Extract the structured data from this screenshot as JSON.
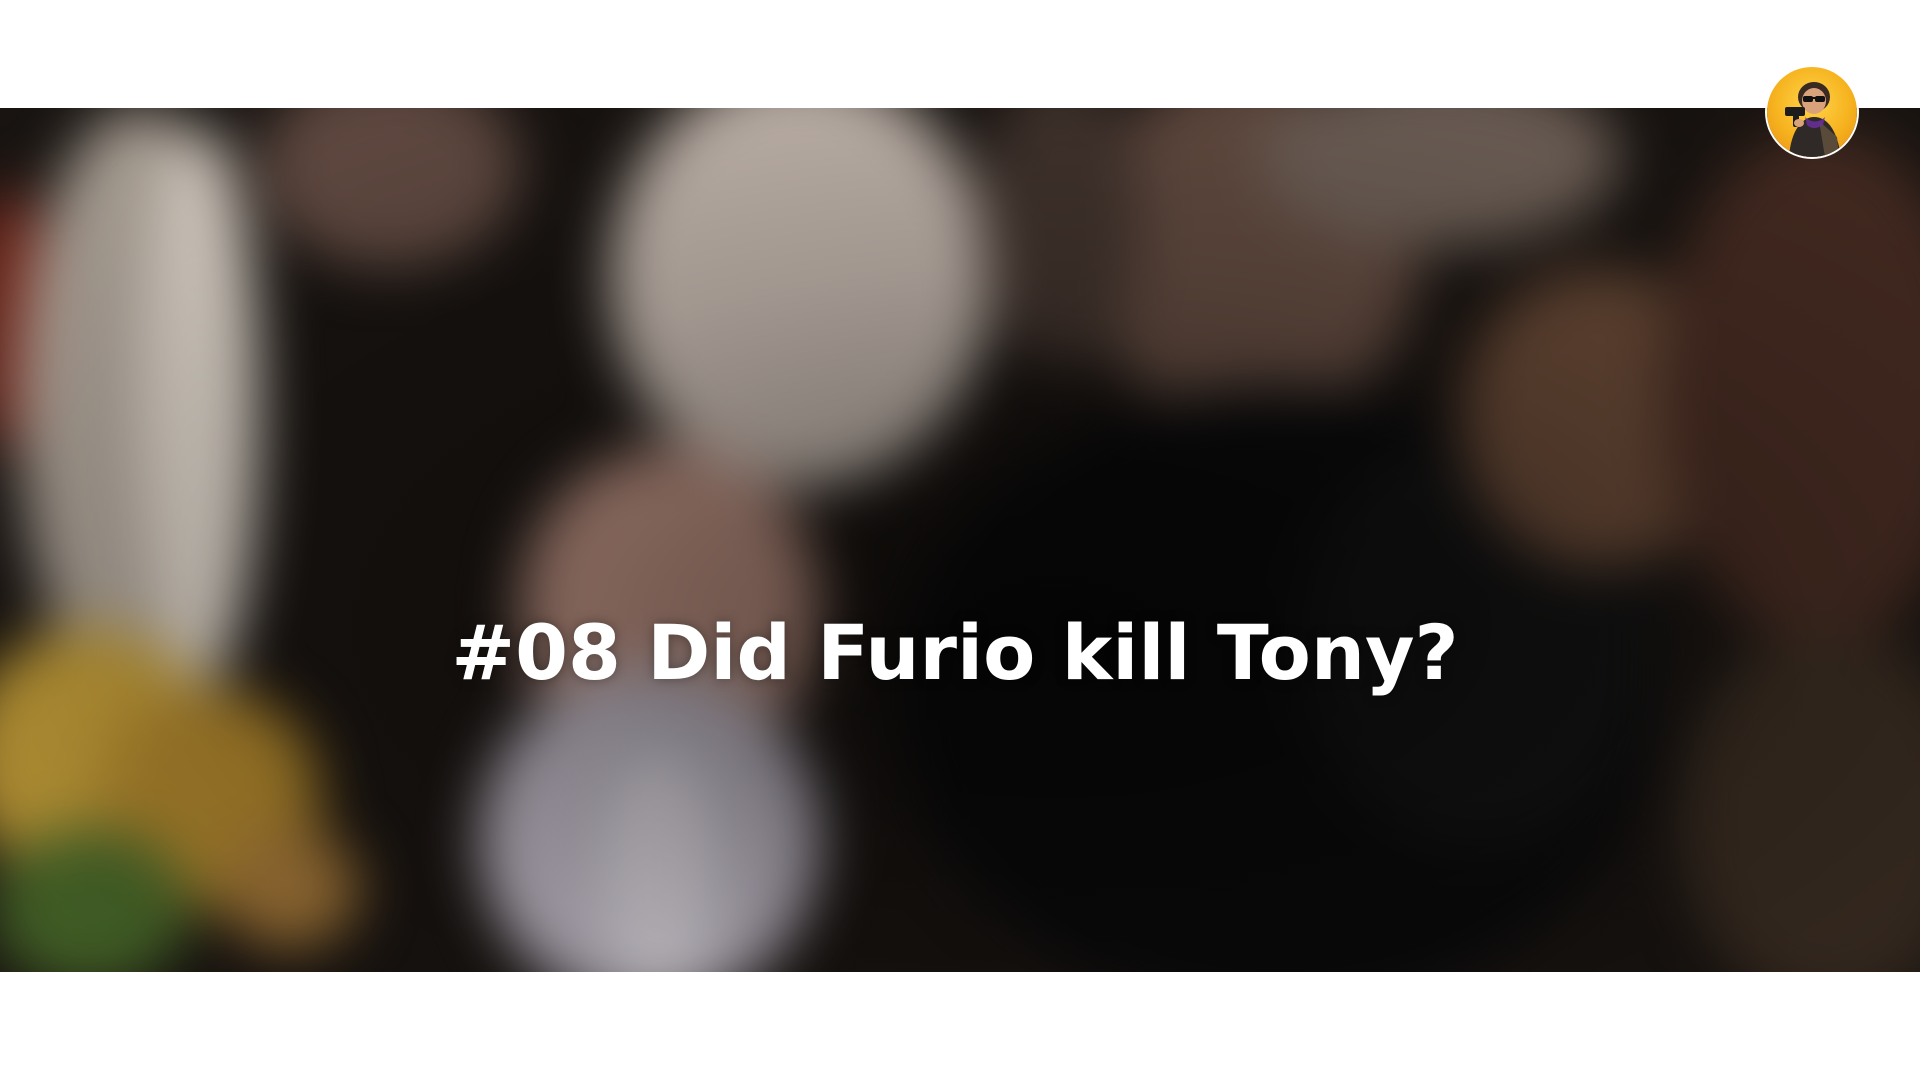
{
  "hero": {
    "title": "#08 Did Furio kill Tony?"
  },
  "avatar": {
    "icon": "profile-avatar-icon",
    "background_color": "#f6b21e"
  }
}
